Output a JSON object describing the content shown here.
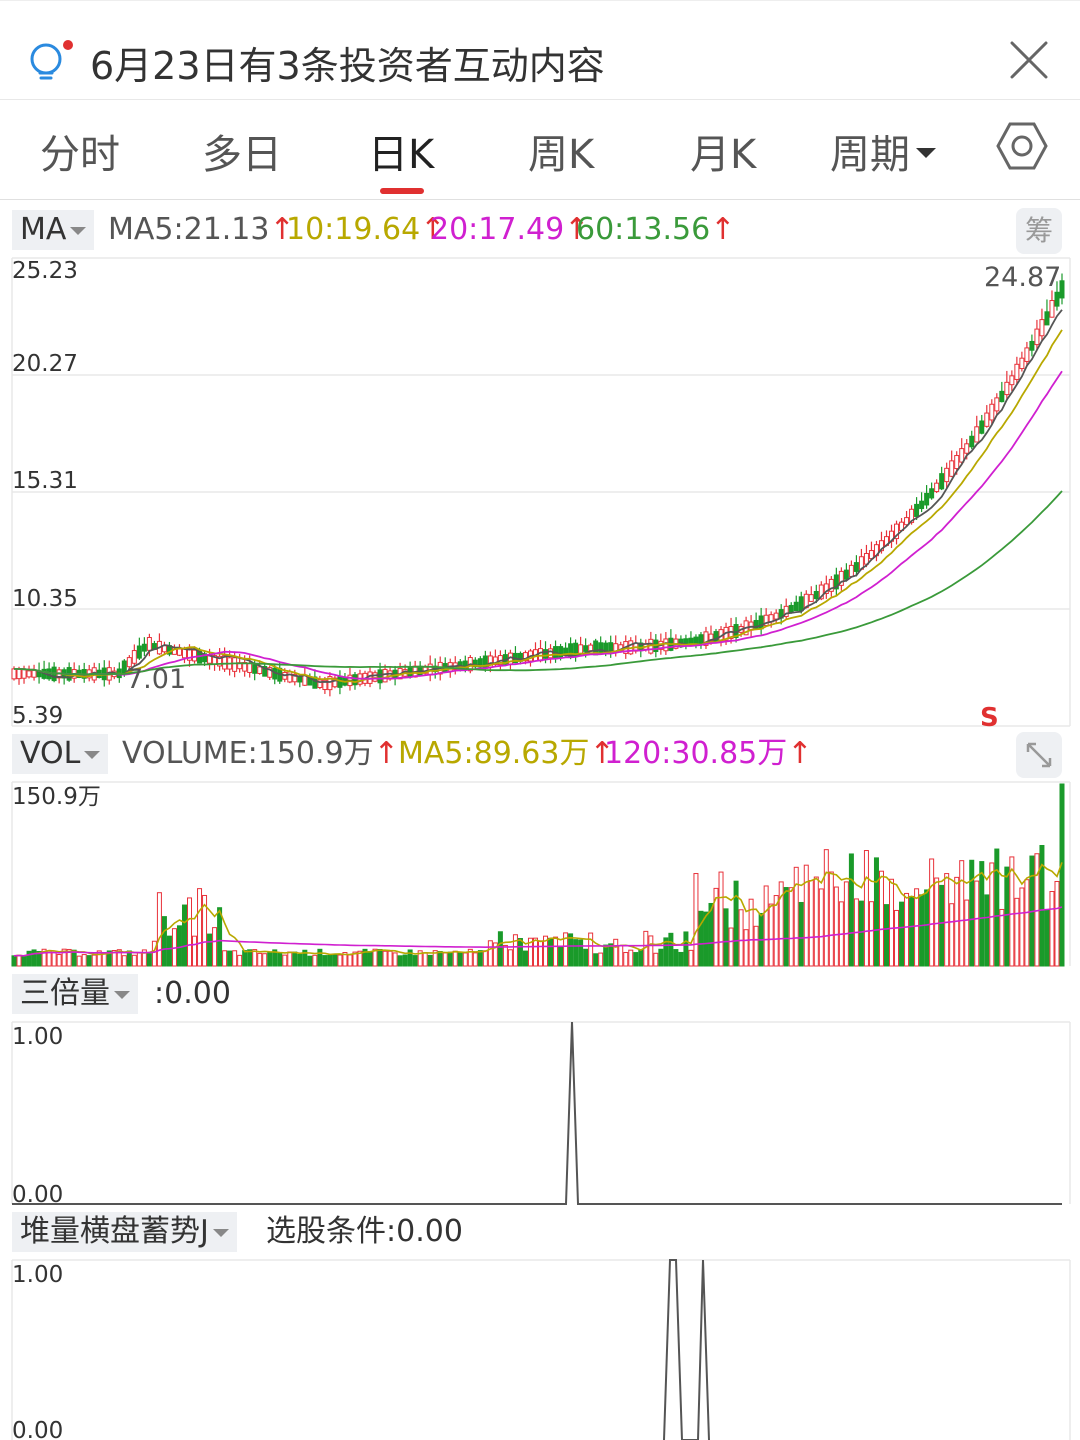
{
  "notice": {
    "text": "6月23日有3条投资者互动内容"
  },
  "tabs": [
    {
      "label": "分时"
    },
    {
      "label": "多日"
    },
    {
      "label": "日K"
    },
    {
      "label": "周K"
    },
    {
      "label": "月K"
    },
    {
      "label": "周期"
    }
  ],
  "active_tab": "日K",
  "ma_panel": {
    "indicator": "MA",
    "legend": [
      {
        "text": "MA5:21.13",
        "color": "#555555"
      },
      {
        "text": "10:19.64",
        "color": "#b8a800"
      },
      {
        "text": "20:17.49",
        "color": "#d020d0"
      },
      {
        "text": "60:13.56",
        "color": "#3a9a3a"
      }
    ],
    "up_arrow": "↑",
    "chip": "筹",
    "y_labels": [
      "25.23",
      "20.27",
      "15.31",
      "10.35",
      "5.39"
    ],
    "high_label": "24.87",
    "low_label": "7.01",
    "signal": "S"
  },
  "vol_panel": {
    "indicator": "VOL",
    "legend": [
      {
        "text": "VOLUME:150.9万",
        "color": "#555555"
      },
      {
        "text": "MA5:89.63万",
        "color": "#b8a800"
      },
      {
        "text": "120:30.85万",
        "color": "#d020d0"
      }
    ],
    "y_label": "150.9万"
  },
  "triple_panel": {
    "indicator": "三倍量",
    "value_text": ":0.00",
    "y_labels": [
      "1.00",
      "0.00"
    ]
  },
  "pile_panel": {
    "indicator": "堆量横盘蓄势J",
    "value_text": "选股条件:0.00",
    "y_labels": [
      "1.00",
      "0.00"
    ]
  },
  "colors": {
    "up": "#e8323a",
    "down": "#1a9a2a",
    "accent": "#e03030",
    "ma5": "#555555",
    "ma10": "#b8a800",
    "ma20": "#d020d0",
    "ma60": "#3a9a3a"
  }
}
